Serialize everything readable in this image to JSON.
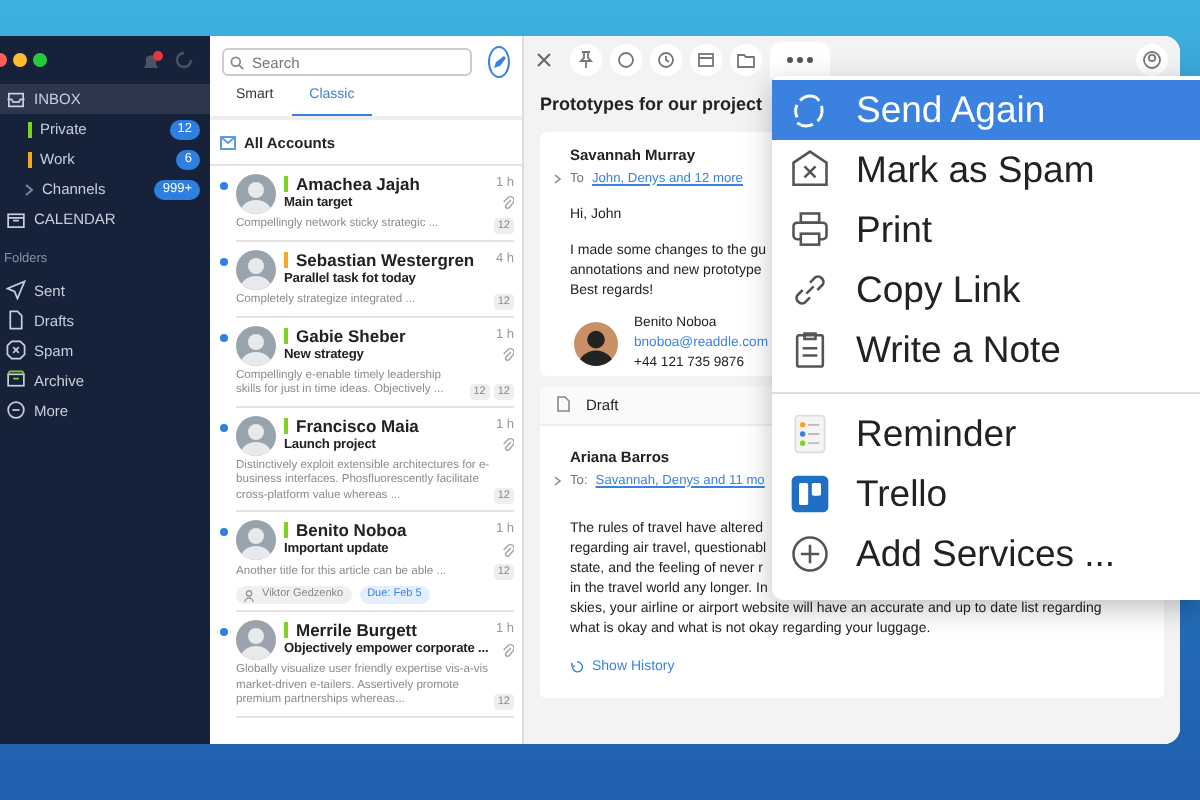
{
  "sidebar": {
    "items": [
      {
        "label": "INBOX",
        "kind": "inbox",
        "selected": true
      },
      {
        "label": "Private",
        "kind": "account",
        "color": "#7ed321",
        "badge": "12",
        "selected": false
      },
      {
        "label": "Work",
        "kind": "account",
        "color": "#f5a623",
        "badge": "6",
        "selected": false
      },
      {
        "label": "Channels",
        "kind": "group",
        "badge": "999+",
        "selected": false
      },
      {
        "label": "CALENDAR",
        "kind": "calendar",
        "selected": false
      }
    ],
    "folders_heading": "Folders",
    "folders": [
      {
        "label": "Sent",
        "kind": "sent"
      },
      {
        "label": "Drafts",
        "kind": "drafts"
      },
      {
        "label": "Spam",
        "kind": "spam"
      },
      {
        "label": "Archive",
        "kind": "archive"
      },
      {
        "label": "More",
        "kind": "more"
      }
    ]
  },
  "list": {
    "search": {
      "placeholder": "Search"
    },
    "tabs": [
      {
        "label": "Smart",
        "selected": false
      },
      {
        "label": "Classic",
        "selected": true
      }
    ],
    "account_header": "All Accounts",
    "emails": [
      {
        "sender": "Amachea Jajah",
        "color": "#7ed321",
        "unread": true,
        "time": "1 h",
        "subject": "Main target",
        "attachment": true,
        "preview": "Compellingly network sticky strategic ...",
        "counts": [
          "12"
        ]
      },
      {
        "sender": "Sebastian Westergren",
        "color": "#f5a623",
        "unread": true,
        "time": "4 h",
        "subject": "Parallel task fot today",
        "attachment": false,
        "preview": "Completely strategize integrated ...",
        "counts": [
          "12"
        ]
      },
      {
        "sender": "Gabie Sheber",
        "color": "#7ed321",
        "unread": true,
        "time": "1 h",
        "subject": "New strategy",
        "attachment": true,
        "preview": "Compellingly e-enable timely leadership skills for just in time ideas. Objectively ...",
        "counts": [
          "12",
          "12"
        ]
      },
      {
        "sender": "Francisco Maia",
        "color": "#7ed321",
        "unread": true,
        "time": "1 h",
        "subject": "Launch project",
        "attachment": true,
        "preview": "Distinctively exploit extensible architectures for e-business interfaces. Phosfluorescently facilitate cross-platform value whereas ...",
        "counts": [
          "12"
        ]
      },
      {
        "sender": "Benito Noboa",
        "color": "#7ed321",
        "unread": true,
        "time": "1 h",
        "subject": "Important update",
        "attachment": true,
        "preview": "Another title for this article can be able ...",
        "counts": [
          "12"
        ],
        "assignee": "Viktor Gedzenko",
        "due": "Due: Feb 5"
      },
      {
        "sender": "Merrile Burgett",
        "color": "#7ed321",
        "unread": true,
        "time": "1 h",
        "subject": "Objectively empower corporate ...",
        "attachment": true,
        "preview": "Globally visualize user friendly expertise vis-a-vis market-driven e-tailers. Assertively promote premium partnerships whereas...",
        "counts": [
          "12"
        ]
      }
    ]
  },
  "reader": {
    "title": "Prototypes for our project",
    "message": {
      "sender": "Savannah Murray",
      "to_prefix": "To",
      "to": "John, Denys and 12 more",
      "greeting": "Hi, John",
      "body_lines": [
        "I made some changes to the gu",
        "annotations and new prototype",
        "Best regards!"
      ],
      "signature": {
        "name": "Benito Noboa",
        "email": "bnoboa@readdle.com",
        "phone": "+44 121 735 9876"
      }
    },
    "draft": {
      "label": "Draft",
      "sender": "Ariana Barros",
      "to_prefix": "To:",
      "to": "Savannah, Denys and 11 mo",
      "body_lines": [
        "The rules of travel have altered",
        "regarding air travel, questionabl",
        "state, and the feeling of never r",
        "in the travel world any longer. In",
        "skies, your airline or airport website will have an accurate and up to date list regarding",
        "what is okay and what is not okay regarding your luggage."
      ],
      "history": "Show History"
    }
  },
  "menu": {
    "actions": [
      {
        "label": "Send Again",
        "kind": "resend",
        "selected": true
      },
      {
        "label": "Mark as Spam",
        "kind": "spam",
        "selected": false
      },
      {
        "label": "Print",
        "kind": "print",
        "selected": false
      },
      {
        "label": "Copy Link",
        "kind": "link",
        "selected": false
      },
      {
        "label": "Write a Note",
        "kind": "note",
        "selected": false
      }
    ],
    "services": [
      {
        "label": "Reminder",
        "kind": "reminder",
        "selected": false
      },
      {
        "label": "Trello",
        "kind": "trello",
        "selected": false
      },
      {
        "label": "Add Services ...",
        "kind": "add",
        "selected": false
      }
    ]
  }
}
